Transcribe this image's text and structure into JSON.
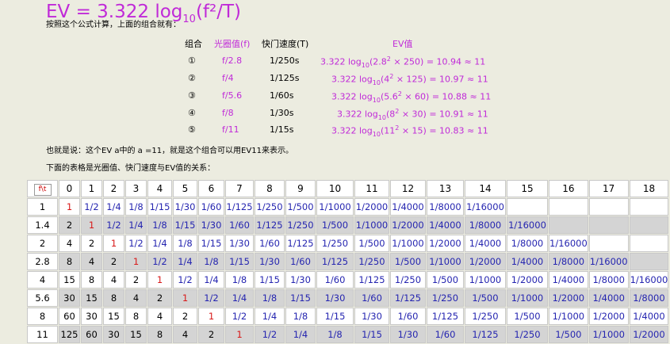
{
  "formula": {
    "prefix": "EV = 3.322 log",
    "sub": "10",
    "suffix": "(f²/T)"
  },
  "intro": "按照这个公式计算，上面的组合就有：",
  "examples": {
    "headers": {
      "combo": "组合",
      "aperture": "光圈值(f)",
      "shutter": "快门速度(T)",
      "ev": "EV值"
    },
    "rows": [
      {
        "num": "①",
        "f": "f/2.8",
        "t": "1/250s",
        "ev": {
          "pre": "3.322 log",
          "sub": "10",
          "open": "(2.8",
          "sup": "2",
          "rest": " × 250) = 10.94  ≈ 11"
        }
      },
      {
        "num": "②",
        "f": "f/4",
        "t": "1/125s",
        "ev": {
          "pre": "3.322 log",
          "sub": "10",
          "open": "(4",
          "sup": "2",
          "rest": " × 125) = 10.97 ≈ 11"
        }
      },
      {
        "num": "③",
        "f": "f/5.6",
        "t": "1/60s",
        "ev": {
          "pre": "3.322 log",
          "sub": "10",
          "open": "(5.6",
          "sup": "2",
          "rest": " × 60) = 10.88 ≈ 11"
        }
      },
      {
        "num": "④",
        "f": "f/8",
        "t": "1/30s",
        "ev": {
          "pre": "3.322 log",
          "sub": "10",
          "open": "(8",
          "sup": "2",
          "rest": " × 30) = 10.91 ≈ 11"
        }
      },
      {
        "num": "⑤",
        "f": "f/11",
        "t": "1/15s",
        "ev": {
          "pre": "3.322 log",
          "sub": "10",
          "open": "(11",
          "sup": "2",
          "rest": " × 15) = 10.83 ≈ 11"
        }
      }
    ]
  },
  "conclusion": "也就是说：这个EV a中的  a =11，就是这个组合可以用EV11来表示。",
  "table_intro": "下面的表格是光圈值、快门速度与EV值的关系：",
  "table": {
    "corner": "f\\t",
    "columns": [
      "0",
      "1",
      "2",
      "3",
      "4",
      "5",
      "6",
      "7",
      "8",
      "9",
      "10",
      "11",
      "12",
      "13",
      "14",
      "15",
      "16",
      "17",
      "18"
    ],
    "rows": [
      {
        "f": "1",
        "cells": [
          "1",
          "1/2",
          "1/4",
          "1/8",
          "1/15",
          "1/30",
          "1/60",
          "1/125",
          "1/250",
          "1/500",
          "1/1000",
          "1/2000",
          "1/4000",
          "1/8000",
          "1/16000",
          "",
          "",
          "",
          ""
        ]
      },
      {
        "f": "1.4",
        "cells": [
          "2",
          "1",
          "1/2",
          "1/4",
          "1/8",
          "1/15",
          "1/30",
          "1/60",
          "1/125",
          "1/250",
          "1/500",
          "1/1000",
          "1/2000",
          "1/4000",
          "1/8000",
          "1/16000",
          "",
          "",
          ""
        ]
      },
      {
        "f": "2",
        "cells": [
          "4",
          "2",
          "1",
          "1/2",
          "1/4",
          "1/8",
          "1/15",
          "1/30",
          "1/60",
          "1/125",
          "1/250",
          "1/500",
          "1/1000",
          "1/2000",
          "1/4000",
          "1/8000",
          "1/16000",
          "",
          ""
        ]
      },
      {
        "f": "2.8",
        "cells": [
          "8",
          "4",
          "2",
          "1",
          "1/2",
          "1/4",
          "1/8",
          "1/15",
          "1/30",
          "1/60",
          "1/125",
          "1/250",
          "1/500",
          "1/1000",
          "1/2000",
          "1/4000",
          "1/8000",
          "1/16000",
          ""
        ]
      },
      {
        "f": "4",
        "cells": [
          "15",
          "8",
          "4",
          "2",
          "1",
          "1/2",
          "1/4",
          "1/8",
          "1/15",
          "1/30",
          "1/60",
          "1/125",
          "1/250",
          "1/500",
          "1/1000",
          "1/2000",
          "1/4000",
          "1/8000",
          "1/16000"
        ]
      },
      {
        "f": "5.6",
        "cells": [
          "30",
          "15",
          "8",
          "4",
          "2",
          "1",
          "1/2",
          "1/4",
          "1/8",
          "1/15",
          "1/30",
          "1/60",
          "1/125",
          "1/250",
          "1/500",
          "1/1000",
          "1/2000",
          "1/4000",
          "1/8000"
        ]
      },
      {
        "f": "8",
        "cells": [
          "60",
          "30",
          "15",
          "8",
          "4",
          "2",
          "1",
          "1/2",
          "1/4",
          "1/8",
          "1/15",
          "1/30",
          "1/60",
          "1/125",
          "1/250",
          "1/500",
          "1/1000",
          "1/2000",
          "1/4000"
        ]
      },
      {
        "f": "11",
        "cells": [
          "125",
          "60",
          "30",
          "15",
          "8",
          "4",
          "2",
          "1",
          "1/2",
          "1/4",
          "1/8",
          "1/15",
          "1/30",
          "1/60",
          "1/125",
          "1/250",
          "1/500",
          "1/1000",
          "1/2000"
        ]
      }
    ]
  },
  "colors": {
    "formula": "#c02ad8",
    "blue_value": "#2525b0",
    "red_value": "#d81818",
    "row_stripe": "#d4d4d4",
    "page_bg": "#ecece0"
  }
}
